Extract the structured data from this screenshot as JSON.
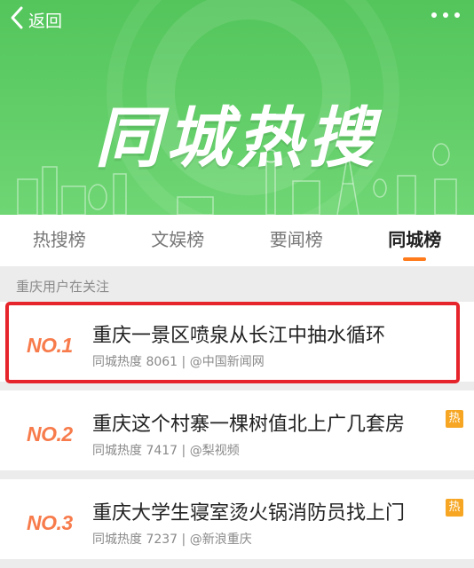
{
  "header": {
    "back_label": "返回",
    "title": "同城热搜"
  },
  "tabs": [
    {
      "label": "热搜榜",
      "active": false
    },
    {
      "label": "文娱榜",
      "active": false
    },
    {
      "label": "要闻榜",
      "active": false
    },
    {
      "label": "同城榜",
      "active": true
    }
  ],
  "section": {
    "label": "重庆用户在关注"
  },
  "items": [
    {
      "rank": "NO.1",
      "title": "重庆一景区喷泉从长江中抽水循环",
      "meta": "同城热度 8061 | @中国新闻网",
      "badge": ""
    },
    {
      "rank": "NO.2",
      "title": "重庆这个村寨一棵树值北上广几套房",
      "meta": "同城热度 7417 | @梨视频",
      "badge": "热"
    },
    {
      "rank": "NO.3",
      "title": "重庆大学生寝室烫火锅消防员找上门",
      "meta": "同城热度 7237 | @新浪重庆",
      "badge": "热"
    }
  ],
  "colors": {
    "hero_green": "#5bcb61",
    "rank_orange": "#f77b4b",
    "tab_indicator": "#ff7a1a",
    "hot_badge": "#f6a623",
    "highlight_red": "#e5242b"
  },
  "icons": {
    "back": "chevron-left-icon",
    "more": "more-dots-icon"
  }
}
